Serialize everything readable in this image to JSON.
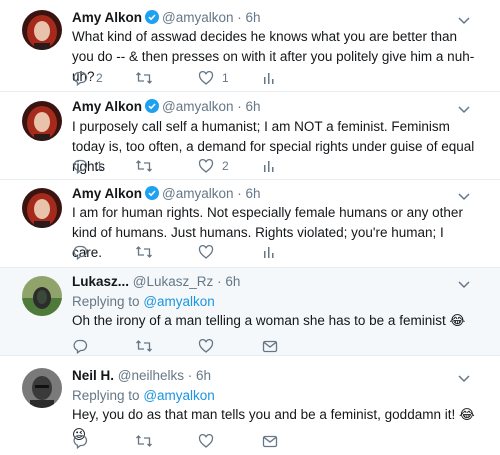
{
  "tweets": [
    {
      "name": "Amy Alkon",
      "handle": "@amyalkon",
      "time": "6h",
      "text": "What kind of asswad decides he knows what you are better than you do -- & then presses on with it after you politely give him a nuh-uh?",
      "replies": "2",
      "retweets": "",
      "likes": "1"
    },
    {
      "name": "Amy Alkon",
      "handle": "@amyalkon",
      "time": "6h",
      "text": "I purposely call self a humanist; I am NOT a feminist. Feminism today is, too often, a demand for special rights under guise of equal rights",
      "replies": "1",
      "retweets": "",
      "likes": "2"
    },
    {
      "name": "Amy Alkon",
      "handle": "@amyalkon",
      "time": "6h",
      "text": "I am for human rights. Not especially female humans or any other kind of humans. Just humans. Rights violated; you're human; I care.",
      "replies": "",
      "retweets": "",
      "likes": ""
    },
    {
      "name": "Lukasz...",
      "handle": "@Lukasz_Rz",
      "time": "6h",
      "replying_prefix": "Replying to",
      "replying_to": "@amyalkon",
      "text": "Oh the irony of a man telling a woman she has to be a feminist 😂"
    },
    {
      "name": "Neil H.",
      "handle": "@neilhelks",
      "time": "6h",
      "replying_prefix": "Replying to",
      "replying_to": "@amyalkon",
      "text": "Hey, you do as that man tells you and be a feminist, goddamn it! 😂😉"
    }
  ],
  "separator": "·",
  "icons": {
    "reply": "reply-icon",
    "retweet": "retweet-icon",
    "like": "heart-icon",
    "analytics": "analytics-icon",
    "message": "direct-message-icon",
    "verified": "verified-badge-icon",
    "caret": "chevron-down-icon"
  },
  "colors": {
    "verified": "#1da1f2",
    "link": "#1b95e0",
    "muted": "#657786",
    "highlight_bg": "#f5f8fa"
  }
}
